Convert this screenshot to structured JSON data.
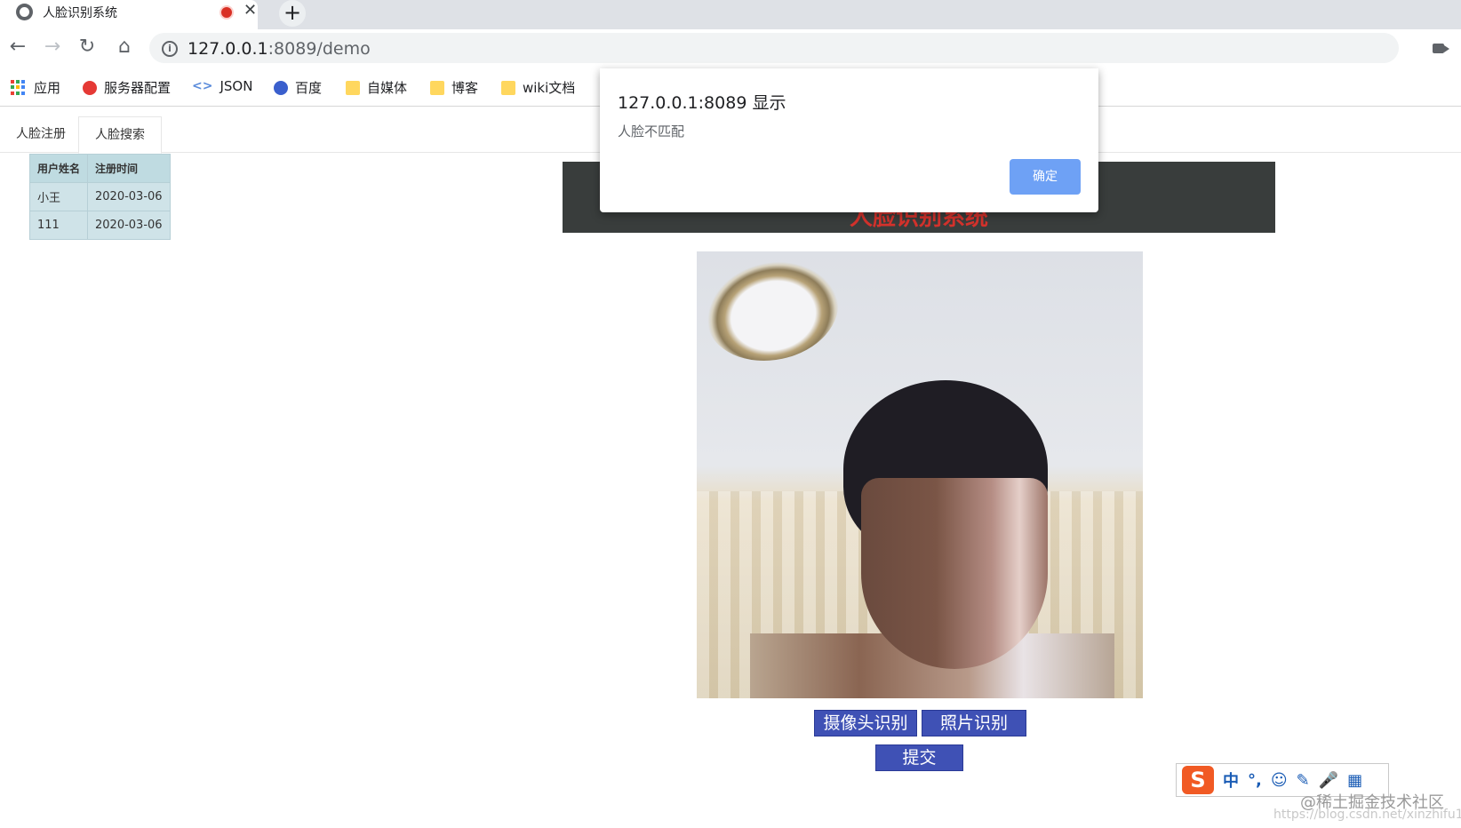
{
  "browser": {
    "tab_title": "人脸识别系统",
    "url_host": "127.0.0.1",
    "url_rest": ":8089/demo",
    "bookmarks": [
      "应用",
      "服务器配置",
      "JSON",
      "百度",
      "自媒体",
      "博客",
      "wiki文档"
    ]
  },
  "page_tabs": [
    "人脸注册",
    "人脸搜索"
  ],
  "user_table": {
    "headers": [
      "用户姓名",
      "注册时间"
    ],
    "rows": [
      [
        "小王",
        "2020-03-06"
      ],
      [
        "111",
        "2020-03-06"
      ]
    ]
  },
  "banner": {
    "title": "人脸识别系统"
  },
  "buttons": {
    "camera": "摄像头识别",
    "photo": "照片识别",
    "submit": "提交"
  },
  "alert": {
    "title": "127.0.0.1:8089 显示",
    "message": "人脸不匹配",
    "ok": "确定"
  },
  "ime": {
    "chinese": "中",
    "punct": "°,"
  },
  "watermark": {
    "line1": "@稀土掘金技术社区",
    "line2": "https://blog.csdn.net/xinzhifu1"
  },
  "colors": {
    "button": "#3f51b5",
    "banner_bg": "#393d3c",
    "table_bg": "#cfe3e8",
    "dialog_ok": "#6ea1f5"
  }
}
